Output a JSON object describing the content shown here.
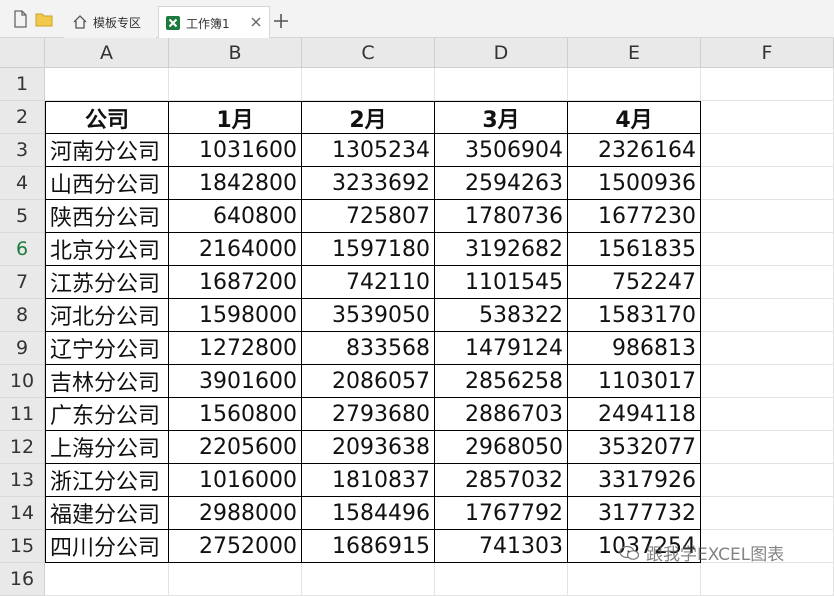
{
  "tabs": {
    "home_label": "模板专区",
    "workbook_label": "工作簿1"
  },
  "columns": [
    "A",
    "B",
    "C",
    "D",
    "E",
    "F"
  ],
  "rows": [
    "1",
    "2",
    "3",
    "4",
    "5",
    "6",
    "7",
    "8",
    "9",
    "10",
    "11",
    "12",
    "13",
    "14",
    "15",
    "16"
  ],
  "table": {
    "headers": [
      "公司",
      "1月",
      "2月",
      "3月",
      "4月"
    ],
    "data": [
      [
        "河南分公司",
        "1031600",
        "1305234",
        "3506904",
        "2326164"
      ],
      [
        "山西分公司",
        "1842800",
        "3233692",
        "2594263",
        "1500936"
      ],
      [
        "陕西分公司",
        "640800",
        "725807",
        "1780736",
        "1677230"
      ],
      [
        "北京分公司",
        "2164000",
        "1597180",
        "3192682",
        "1561835"
      ],
      [
        "江苏分公司",
        "1687200",
        "742110",
        "1101545",
        "752247"
      ],
      [
        "河北分公司",
        "1598000",
        "3539050",
        "538322",
        "1583170"
      ],
      [
        "辽宁分公司",
        "1272800",
        "833568",
        "1479124",
        "986813"
      ],
      [
        "吉林分公司",
        "3901600",
        "2086057",
        "2856258",
        "1103017"
      ],
      [
        "广东分公司",
        "1560800",
        "2793680",
        "2886703",
        "2494118"
      ],
      [
        "上海分公司",
        "2205600",
        "2093638",
        "2968050",
        "3532077"
      ],
      [
        "浙江分公司",
        "1016000",
        "1810837",
        "2857032",
        "3317926"
      ],
      [
        "福建分公司",
        "2988000",
        "1584496",
        "1767792",
        "3177732"
      ],
      [
        "四川分公司",
        "2752000",
        "1686915",
        "741303",
        "1037254"
      ]
    ]
  },
  "watermark": "跟我学EXCEL图表",
  "colors": {
    "excel_green": "#1d7a3e",
    "header_bg": "#e9e9e9"
  }
}
